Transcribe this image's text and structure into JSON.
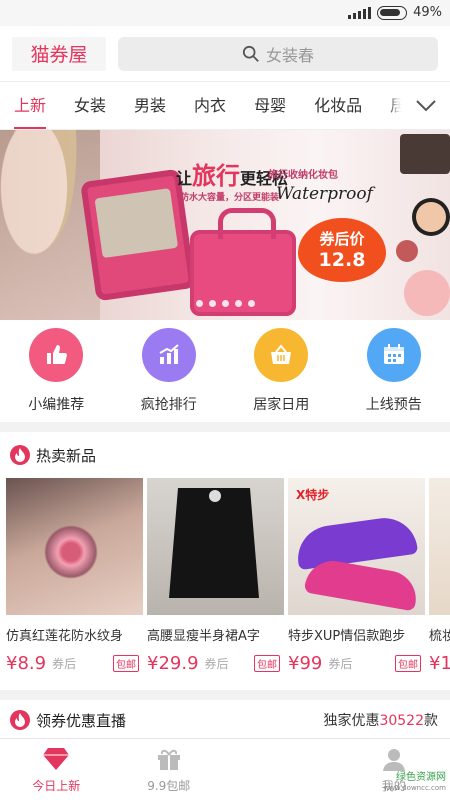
{
  "status": {
    "battery": "49%"
  },
  "header": {
    "logo": "猫券屋",
    "search_placeholder": "女装春"
  },
  "tabs": [
    {
      "label": "上新",
      "active": true
    },
    {
      "label": "女装"
    },
    {
      "label": "男装"
    },
    {
      "label": "内衣"
    },
    {
      "label": "母婴"
    },
    {
      "label": "化妆品"
    },
    {
      "label": "居"
    }
  ],
  "banner": {
    "headline_pre": "让",
    "headline_big": "旅行",
    "headline_post": "更轻松",
    "tagline": "旅行收纳化妆包",
    "sub": "防水大容量，分区更能装",
    "english": "Waterproof",
    "price_label": "券后价",
    "price_value": "12.8"
  },
  "categories": [
    {
      "label": "小编推荐",
      "color": "#f25b7f",
      "icon": "thumb-up-icon"
    },
    {
      "label": "疯抢排行",
      "color": "#9b7bf2",
      "icon": "chart-icon"
    },
    {
      "label": "居家日用",
      "color": "#f7b731",
      "icon": "basket-icon"
    },
    {
      "label": "上线预告",
      "color": "#53a8f5",
      "icon": "calendar-icon"
    }
  ],
  "hot": {
    "title": "热卖新品",
    "products": [
      {
        "name": "仿真红莲花防水纹身",
        "price": "¥8.9",
        "coupon": "券后",
        "tag": "包邮"
      },
      {
        "name": "高腰显瘦半身裙A字",
        "price": "¥29.9",
        "coupon": "券后",
        "tag": "包邮"
      },
      {
        "name": "特步XUP情侣款跑步",
        "price": "¥99",
        "coupon": "券后",
        "tag": "包邮"
      },
      {
        "name": "梳妆",
        "price": "¥1",
        "coupon": "",
        "tag": ""
      }
    ]
  },
  "live": {
    "title": "领券优惠直播",
    "right_pre": "独家优惠",
    "right_count": "30522",
    "right_post": "款"
  },
  "bottomnav": [
    {
      "label": "今日上新",
      "active": true
    },
    {
      "label": "9.9包邮"
    },
    {
      "label": ""
    },
    {
      "label": "我的"
    }
  ],
  "watermark": {
    "line1": "绿色资源网",
    "line2": "www.downcc.com"
  }
}
